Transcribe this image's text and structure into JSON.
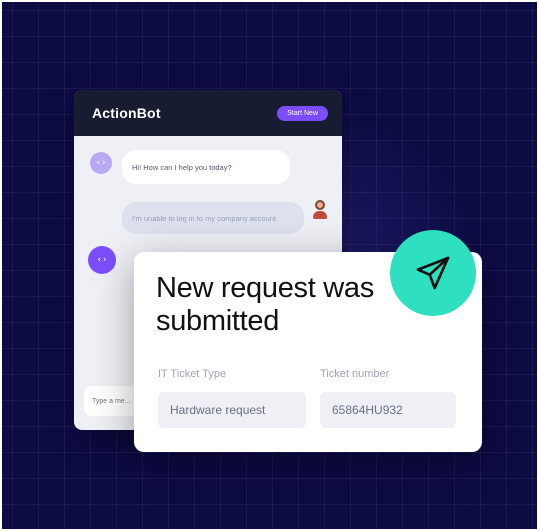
{
  "chat": {
    "title": "ActionBot",
    "header_button": "Start New",
    "bot_message": "Hi! How can I help you today?",
    "user_message": "I'm unable to log in to my company account",
    "input_placeholder": "Type a me..."
  },
  "card": {
    "title": "New request was submitted",
    "ticket_type_label": "IT Ticket Type",
    "ticket_type_value": "Hardware request",
    "ticket_number_label": "Ticket number",
    "ticket_number_value": "65864HU932"
  },
  "icons": {
    "send": "paper-plane-icon",
    "bot": "code-bracket-icon",
    "user": "user-avatar-icon"
  },
  "colors": {
    "background": "#0d0b44",
    "accent_purple": "#7b4dff",
    "accent_teal": "#2fe0c0",
    "chat_header": "#181c33"
  }
}
